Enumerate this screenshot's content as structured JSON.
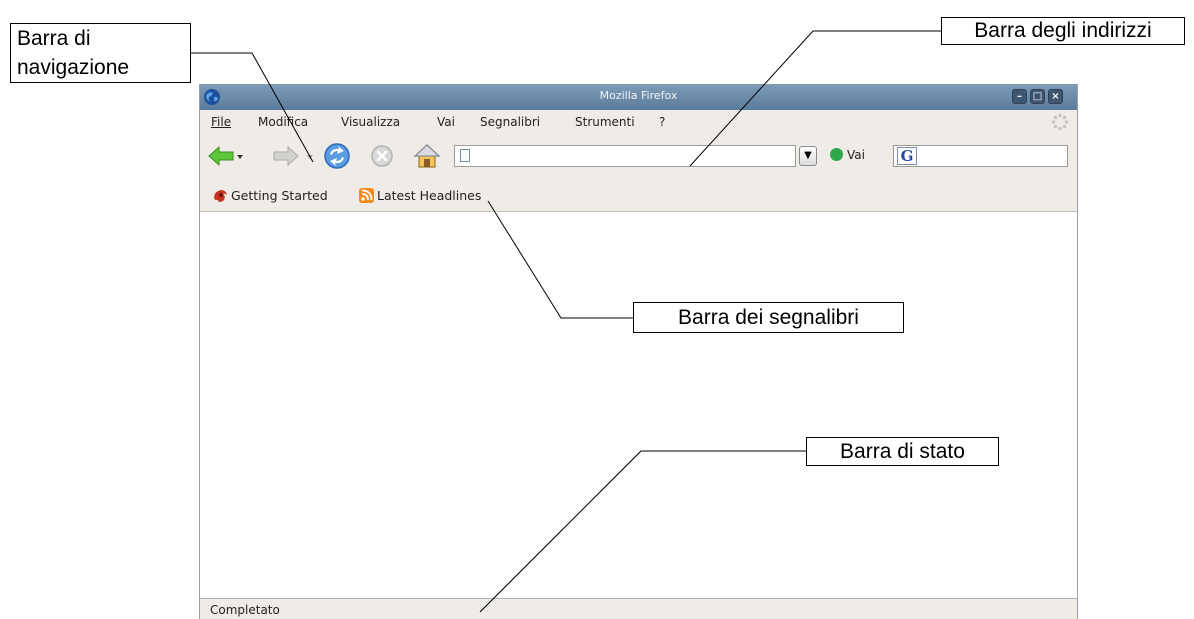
{
  "annotations": {
    "navigation_bar": "Barra di navigazione",
    "address_bar": "Barra degli indirizzi",
    "bookmarks_bar": "Barra dei segnalibri",
    "status_bar": "Barra di stato"
  },
  "window": {
    "title": "Mozilla Firefox",
    "controls": [
      "minimize",
      "maximize",
      "close"
    ]
  },
  "menu": [
    "File",
    "Modifica",
    "Visualizza",
    "Vai",
    "Segnalibri",
    "Strumenti",
    "?"
  ],
  "navbar": {
    "buttons": [
      "back-icon",
      "forward-icon",
      "reload-icon",
      "stop-icon",
      "home-icon"
    ],
    "url_value": "",
    "go_label": "Vai",
    "search_value": ""
  },
  "bookmarks": [
    {
      "label": "Getting Started",
      "icon": "firefox-icon"
    },
    {
      "label": "Latest Headlines",
      "icon": "rss-icon"
    }
  ],
  "status": {
    "text": "Completato"
  },
  "colors": {
    "titlebar": "#6f8daa",
    "chrome": "#efebe7",
    "back_arrow": "#4cb82f"
  }
}
